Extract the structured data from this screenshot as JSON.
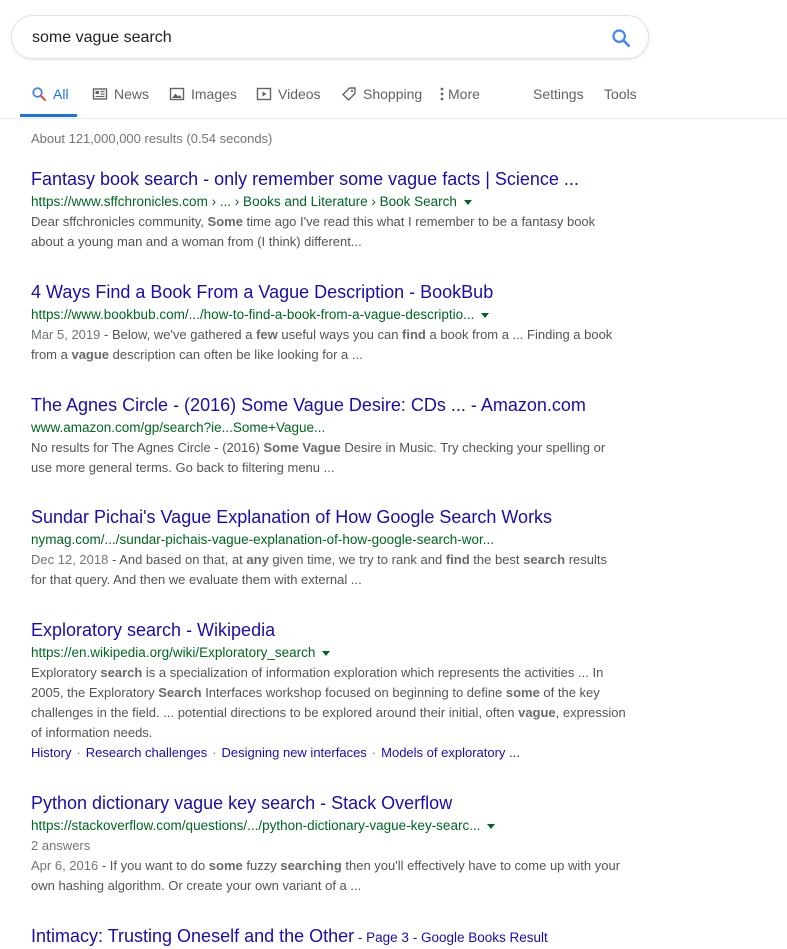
{
  "search": {
    "query": "some vague search"
  },
  "tabs": [
    {
      "label": "All"
    },
    {
      "label": "News"
    },
    {
      "label": "Images"
    },
    {
      "label": "Videos"
    },
    {
      "label": "Shopping"
    },
    {
      "label": "More"
    },
    {
      "label": "Settings"
    },
    {
      "label": "Tools"
    }
  ],
  "stats": "About 121,000,000 results (0.54 seconds)",
  "accent_color": "#1a73e8",
  "results": [
    {
      "title": "Fantasy book search - only remember some vague facts | Science ...",
      "url": "https://www.sffchronicles.com › ... › Books and Literature › Book Search",
      "snippet": [
        [
          [
            "Dear sffchronicles community, ",
            false
          ],
          [
            "Some",
            true
          ],
          [
            " time ago I've read this what I remember to be a fantasy book",
            false
          ]
        ],
        [
          [
            "about a young man and a woman from (I think) different...",
            false
          ]
        ]
      ]
    },
    {
      "title": "4 Ways Find a Book From a Vague Description - BookBub",
      "url": "https://www.bookbub.com/.../how-to-find-a-book-from-a-vague-descriptio...",
      "date": "Mar 5, 2019",
      "snippet": [
        [
          [
            "Below, we've gathered a ",
            false
          ],
          [
            "few",
            true
          ],
          [
            " useful ways you can ",
            false
          ],
          [
            "find",
            true
          ],
          [
            " a book from a ... Finding a book",
            false
          ]
        ],
        [
          [
            "from a ",
            false
          ],
          [
            "vague",
            true
          ],
          [
            " description can often be like looking for a ...",
            false
          ]
        ]
      ]
    },
    {
      "title": "The Agnes Circle - (2016) Some Vague Desire: CDs ... - Amazon.com",
      "url": "www.amazon.com/gp/search?ie...Some+Vague...",
      "snippet": [
        [
          [
            "No results for The Agnes Circle - (2016) ",
            false
          ],
          [
            "Some Vague",
            true
          ],
          [
            " Desire in Music. Try checking your spelling or",
            false
          ]
        ],
        [
          [
            "use more general terms. Go back to filtering menu ...",
            false
          ]
        ]
      ]
    },
    {
      "title": "Sundar Pichai's Vague Explanation of How Google Search Works",
      "url": "nymag.com/.../sundar-pichais-vague-explanation-of-how-google-search-wor...",
      "date": "Dec 12, 2018",
      "snippet": [
        [
          [
            "And based on that, at ",
            false
          ],
          [
            "any",
            true
          ],
          [
            " given time, we try to rank and ",
            false
          ],
          [
            "find",
            true
          ],
          [
            " the best ",
            false
          ],
          [
            "search",
            true
          ],
          [
            " results",
            false
          ]
        ],
        [
          [
            "for that query. And then we evaluate them with external ...",
            false
          ]
        ]
      ]
    },
    {
      "title": "Exploratory search - Wikipedia",
      "url": "https://en.wikipedia.org/wiki/Exploratory_search",
      "snippet": [
        [
          [
            "Exploratory ",
            false
          ],
          [
            "search",
            true
          ],
          [
            " is a specialization of information exploration which represents the activities ... In",
            false
          ]
        ],
        [
          [
            "2005, the Exploratory ",
            false
          ],
          [
            "Search",
            true
          ],
          [
            " Interfaces workshop focused on beginning to define ",
            false
          ],
          [
            "some",
            true
          ],
          [
            " of the key",
            false
          ]
        ],
        [
          [
            "challenges in the field. ... potential directions to be explored around their initial, often ",
            false
          ],
          [
            "vague",
            true
          ],
          [
            ", expression",
            false
          ]
        ],
        [
          [
            "of information needs.",
            false
          ]
        ]
      ],
      "sitelinks": [
        "History",
        "Research challenges",
        "Designing new interfaces",
        "Models of exploratory ..."
      ]
    },
    {
      "title": "Python dictionary vague key search - Stack Overflow",
      "url": "https://stackoverflow.com/questions/.../python-dictionary-vague-key-searc...",
      "meta": "2 answers",
      "date": "Apr 6, 2016",
      "snippet": [
        [
          [
            "If you want to do ",
            false
          ],
          [
            "some",
            true
          ],
          [
            " fuzzy ",
            false
          ],
          [
            "searching",
            true
          ],
          [
            " then you'll effectively have to come up with your",
            false
          ]
        ],
        [
          [
            "own hashing algorithm. Or create your own variant of a ...",
            false
          ]
        ]
      ]
    },
    {
      "title": "Intimacy: Trusting Oneself and the Other",
      "title_extra": " - Page 3 - Google Books Result"
    }
  ]
}
